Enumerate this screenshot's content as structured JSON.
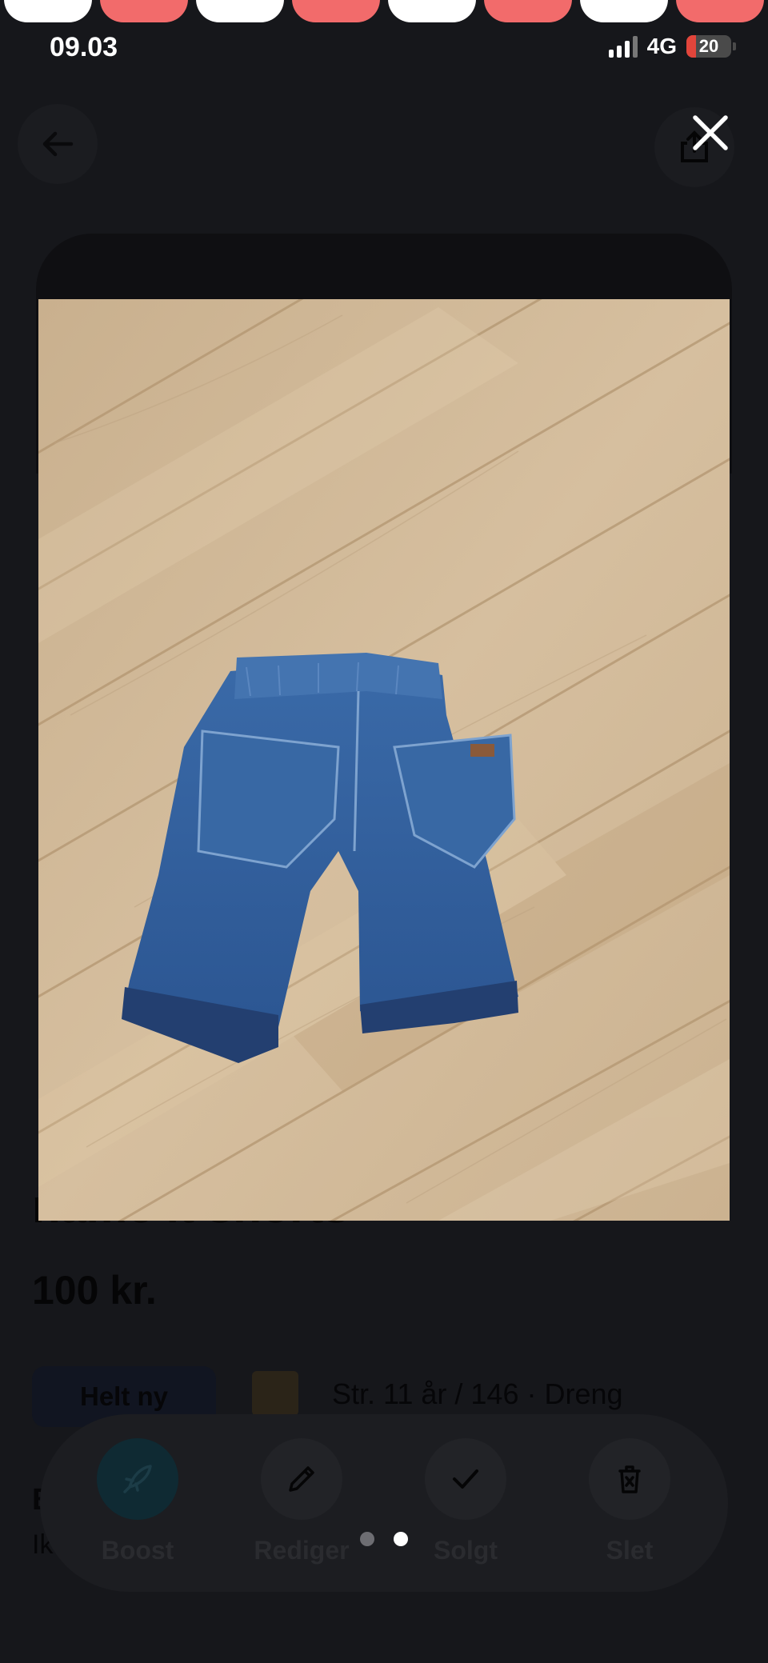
{
  "status_bar": {
    "time": "09.03",
    "network": "4G",
    "battery": "20"
  },
  "listing": {
    "title": "name it shorts",
    "price": "100 kr.",
    "condition": "Helt ny",
    "size_info": "Str. 11 år / 146 · Dreng",
    "description_heading": "B",
    "description_text": "Ik"
  },
  "actions": [
    {
      "label": "Boost",
      "icon": "rocket-icon"
    },
    {
      "label": "Rediger",
      "icon": "pencil-icon"
    },
    {
      "label": "Solgt",
      "icon": "check-icon"
    },
    {
      "label": "Slet",
      "icon": "trash-icon"
    }
  ],
  "gallery": {
    "image_count": 2,
    "active_index": 2
  },
  "colors": {
    "background": "#16171b",
    "accent_red": "#f26b6b",
    "battery_red": "#e2453b",
    "boost_accent": "#0f2a33"
  }
}
